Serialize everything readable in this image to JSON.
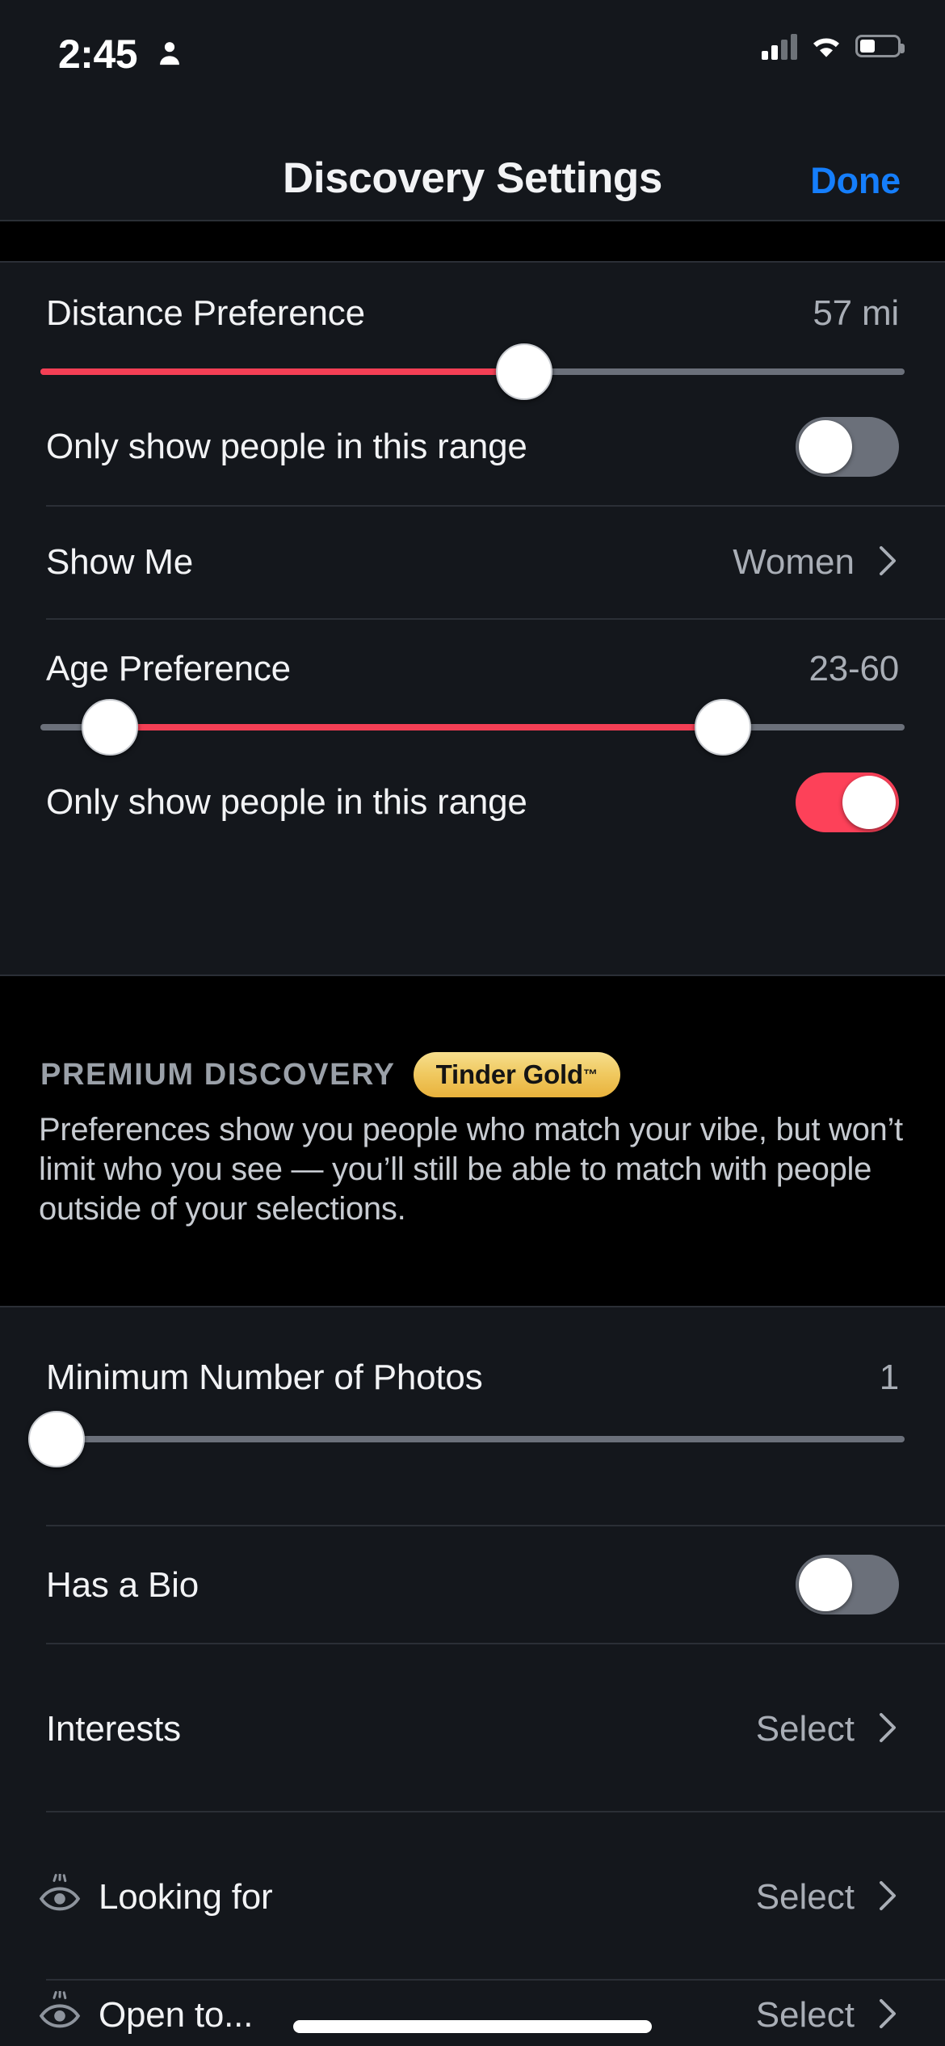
{
  "status_bar": {
    "time": "2:45",
    "icons": [
      "person-icon",
      "cellular-signal-icon",
      "wifi-icon",
      "battery-icon"
    ]
  },
  "nav": {
    "title": "Discovery Settings",
    "done_label": "Done"
  },
  "section_one": {
    "distance": {
      "label": "Distance Preference",
      "value": "57 mi",
      "slider": {
        "percent": 56,
        "min_label": "",
        "max_label": ""
      }
    },
    "distance_toggle": {
      "label": "Only show people in this range",
      "state": "off"
    },
    "show_me": {
      "label": "Show Me",
      "value": "Women",
      "accessory": "chevron-right-icon"
    },
    "age": {
      "label": "Age Preference",
      "value": "23-60",
      "slider": {
        "low_percent": 8,
        "high_percent": 79
      }
    },
    "age_toggle": {
      "label": "Only show people in this range",
      "state": "on"
    }
  },
  "premium": {
    "heading": "PREMIUM DISCOVERY",
    "badge": "Tinder Gold",
    "badge_tm": "™",
    "description": "Preferences show you people who match your vibe, but won’t limit who you see — you’ll still be able to match with people outside of your selections."
  },
  "section_two": {
    "min_photos": {
      "label": "Minimum Number of Photos",
      "value": "1",
      "slider": {
        "percent": 0
      }
    },
    "has_bio": {
      "label": "Has a Bio",
      "state": "off"
    },
    "interests": {
      "label": "Interests",
      "value": "Select",
      "accessory": "chevron-right-icon"
    },
    "looking_for": {
      "label": "Looking for",
      "value": "Select",
      "icon": "eye-icon",
      "accessory": "chevron-right-icon"
    },
    "open_to": {
      "label": "Open to...",
      "value": "Select",
      "icon": "eye-icon",
      "accessory": "chevron-right-icon"
    }
  },
  "colors": {
    "accent_red": "#FD4159",
    "link_blue": "#157EFB",
    "card_bg": "#14171C",
    "page_bg": "#000000",
    "gold": "#F0C960",
    "muted_text": "#A9AEB6"
  }
}
